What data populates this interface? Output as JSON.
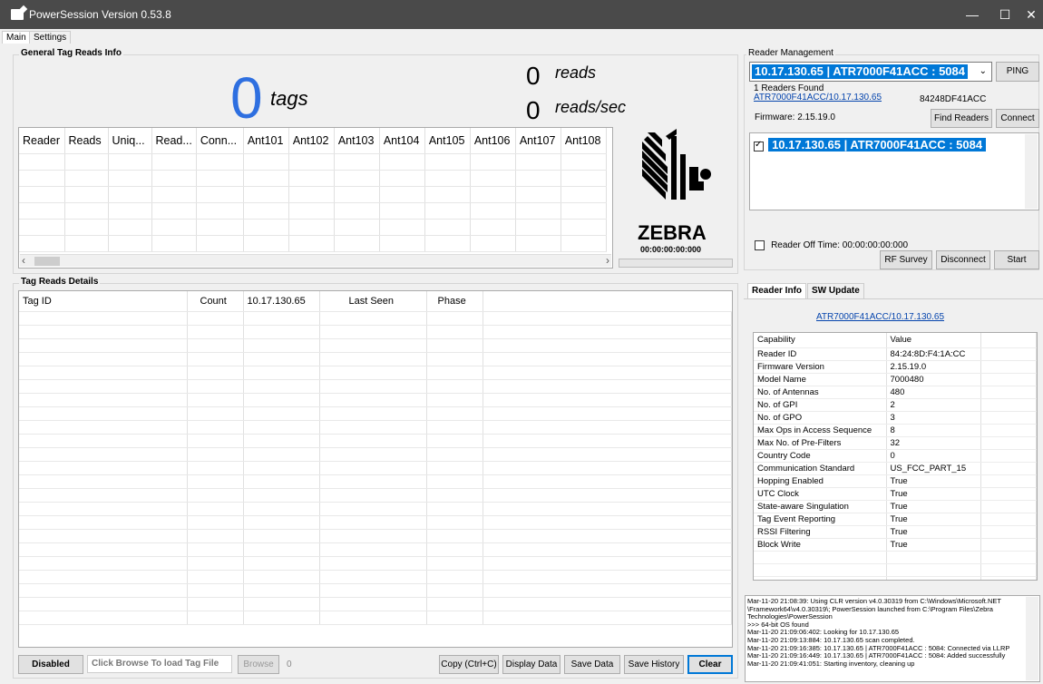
{
  "window": {
    "title": "PowerSession  Version 0.53.8",
    "min": "—",
    "max": "☐",
    "close": "✕"
  },
  "tabs": [
    "Main",
    "Settings"
  ],
  "general": {
    "group_title": "General Tag Reads Info",
    "tags_count": "0",
    "tags_label": "tags",
    "reads_count": "0",
    "reads_label": "reads",
    "rate_count": "0",
    "rate_label": "reads/sec",
    "columns": [
      "Reader",
      "Reads",
      "Uniq...",
      "Read...",
      "Conn...",
      "Ant101",
      "Ant102",
      "Ant103",
      "Ant104",
      "Ant105",
      "Ant106",
      "Ant107",
      "Ant108"
    ],
    "logo_text": "ZEBRA",
    "timer": "00:00:00:00:000"
  },
  "details": {
    "group_title": "Tag Reads Details",
    "columns": [
      "Tag ID",
      "Count",
      "10.17.130.65",
      "Last Seen",
      "Phase"
    ],
    "disabled_label": "Disabled",
    "file_placeholder": "Click Browse To load Tag File",
    "browse_label": "Browse",
    "browse_count": "0",
    "copy_label": "Copy (Ctrl+C)",
    "display_label": "Display Data",
    "save_data_label": "Save Data",
    "save_history_label": "Save History",
    "clear_label": "Clear"
  },
  "reader_mgmt": {
    "group_title": "Reader Management",
    "selected_reader": "10.17.130.65  |  ATR7000F41ACC : 5084",
    "ping_label": "PING",
    "found_text": "1 Readers Found",
    "found_link": "ATR7000F41ACC/10.17.130.65",
    "mac_text": "84248DF41ACC",
    "firmware_text": "Firmware: 2.15.19.0",
    "find_label": "Find Readers",
    "connect_label": "Connect",
    "list_item": "10.17.130.65  |  ATR7000F41ACC : 5084",
    "off_time_label": "Reader Off Time:  00:00:00:00:000",
    "rf_survey_label": "RF Survey",
    "disconnect_label": "Disconnect",
    "start_label": "Start"
  },
  "reader_info": {
    "tabs": [
      "Reader Info",
      "SW Update"
    ],
    "link": "ATR7000F41ACC/10.17.130.65",
    "header": [
      "Capability",
      "Value"
    ],
    "rows": [
      [
        "Reader ID",
        "84:24:8D:F4:1A:CC"
      ],
      [
        "Firmware Version",
        "2.15.19.0"
      ],
      [
        "Model Name",
        "7000480"
      ],
      [
        "No. of Antennas",
        "480"
      ],
      [
        "No. of GPI",
        "2"
      ],
      [
        "No. of GPO",
        "3"
      ],
      [
        "Max Ops in Access Sequence",
        "8"
      ],
      [
        "Max No. of Pre-Filters",
        "32"
      ],
      [
        "Country Code",
        "0"
      ],
      [
        "Communication Standard",
        "US_FCC_PART_15"
      ],
      [
        "Hopping Enabled",
        "True"
      ],
      [
        "UTC Clock",
        "True"
      ],
      [
        "State-aware Singulation",
        "True"
      ],
      [
        "Tag Event Reporting",
        "True"
      ],
      [
        "RSSI Filtering",
        "True"
      ],
      [
        "Block Write",
        "True"
      ]
    ]
  },
  "log": [
    "Mar-11-20 21:08:39: Using CLR version v4.0.30319 from C:\\Windows\\Microsoft.NET",
    "\\Framework64\\v4.0.30319\\; PowerSession launched from C:\\Program Files\\Zebra",
    "Technologies\\PowerSession",
    ">>> 64-bit OS found",
    "Mar-11-20 21:09:06:402: Looking for 10.17.130.65",
    "Mar-11-20 21:09:13:884: 10.17.130.65 scan completed.",
    "Mar-11-20 21:09:16:385: 10.17.130.65 | ATR7000F41ACC : 5084: Connected via LLRP",
    "Mar-11-20 21:09:16:449: 10.17.130.65 | ATR7000F41ACC : 5084: Added successfully",
    "Mar-11-20 21:09:41:051: Starting inventory, cleaning up"
  ]
}
